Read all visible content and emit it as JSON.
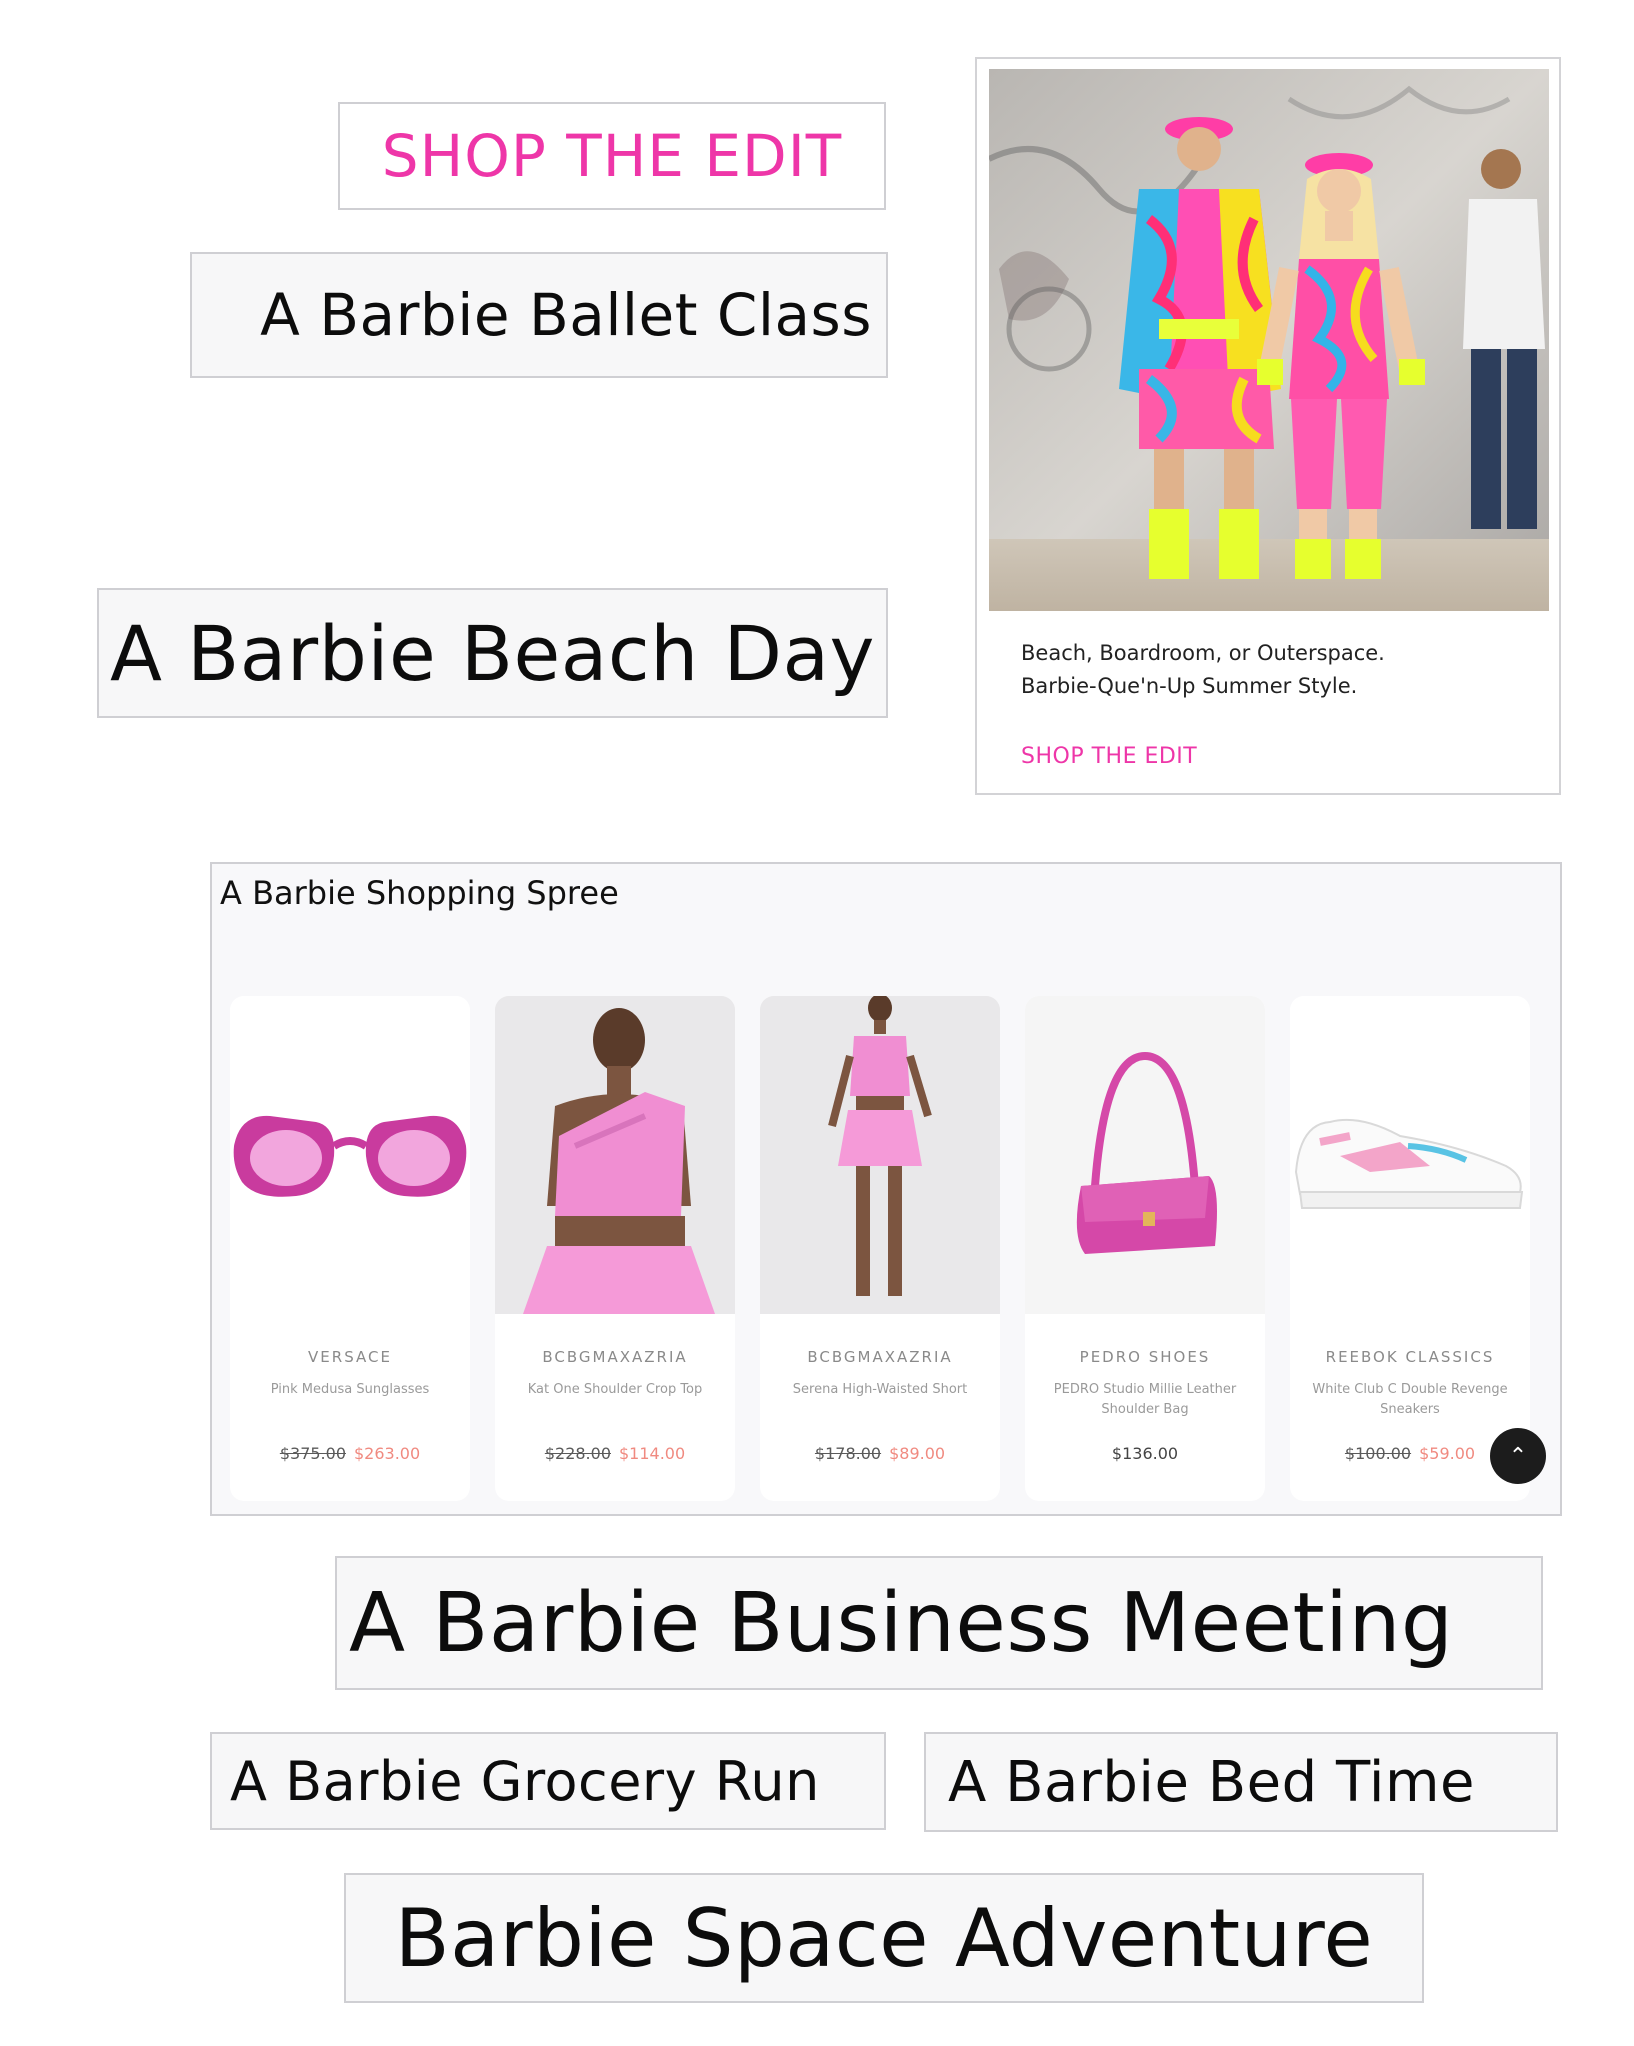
{
  "shop_edit_top": "SHOP THE EDIT",
  "ballet": "A Barbie Ballet Class",
  "beach": "A Barbie Beach Day",
  "promo": {
    "caption_line1": "Beach, Boardroom, or Outerspace.",
    "caption_line2": "Barbie-Que'n-Up Summer Style.",
    "cta": "SHOP THE EDIT"
  },
  "spree": {
    "title": "A Barbie Shopping Spree",
    "products": [
      {
        "brand": "VERSACE",
        "name": "Pink Medusa Sunglasses",
        "old_price": "$375.00",
        "price": "$263.00"
      },
      {
        "brand": "BCBGMAXAZRIA",
        "name": "Kat One Shoulder Crop Top",
        "old_price": "$228.00",
        "price": "$114.00"
      },
      {
        "brand": "BCBGMAXAZRIA",
        "name": "Serena High-Waisted Short",
        "old_price": "$178.00",
        "price": "$89.00"
      },
      {
        "brand": "PEDRO SHOES",
        "name": "PEDRO Studio Millie Leather Shoulder Bag",
        "price": "$136.00"
      },
      {
        "brand": "REEBOK CLASSICS",
        "name": "White Club C Double Revenge Sneakers",
        "old_price": "$100.00",
        "price": "$59.00"
      }
    ],
    "scroll_icon": "chevron-up-icon"
  },
  "business": "A Barbie Business Meeting",
  "grocery": "A Barbie Grocery Run",
  "bedtime": "A Barbie Bed Time",
  "space": "Barbie Space Adventure",
  "colors": {
    "accent_pink": "#ee36a8",
    "sale_price": "#f08a80"
  }
}
